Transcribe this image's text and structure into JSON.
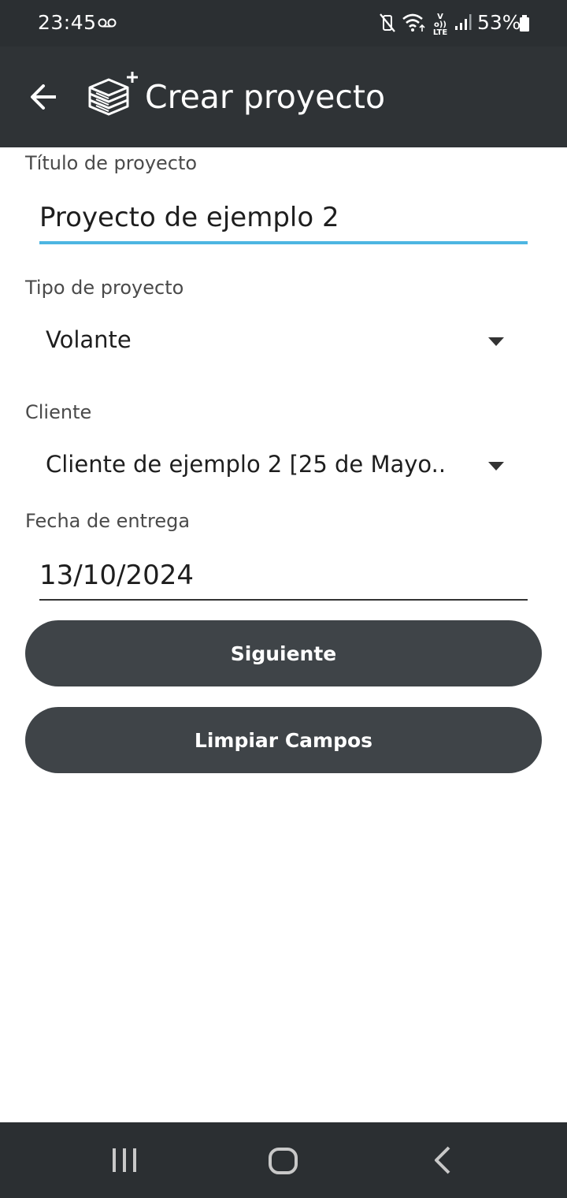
{
  "status_bar": {
    "time": "23:45",
    "volte": "Vo)) LTE",
    "battery_percent": "53%"
  },
  "app_bar": {
    "title": "Crear proyecto"
  },
  "form": {
    "title_field": {
      "label": "Título de proyecto",
      "value": "Proyecto de ejemplo 2"
    },
    "type_field": {
      "label": "Tipo de proyecto",
      "value": "Volante"
    },
    "client_field": {
      "label": "Cliente",
      "value": "Cliente de ejemplo 2 [25 de Mayo.."
    },
    "date_field": {
      "label": "Fecha de entrega",
      "value": "13/10/2024"
    }
  },
  "buttons": {
    "next_label": "Siguiente",
    "clear_label": "Limpiar Campos"
  },
  "colors": {
    "accent": "#4db6e2",
    "bar_background": "#2f3336",
    "button_background": "#3f4448"
  }
}
